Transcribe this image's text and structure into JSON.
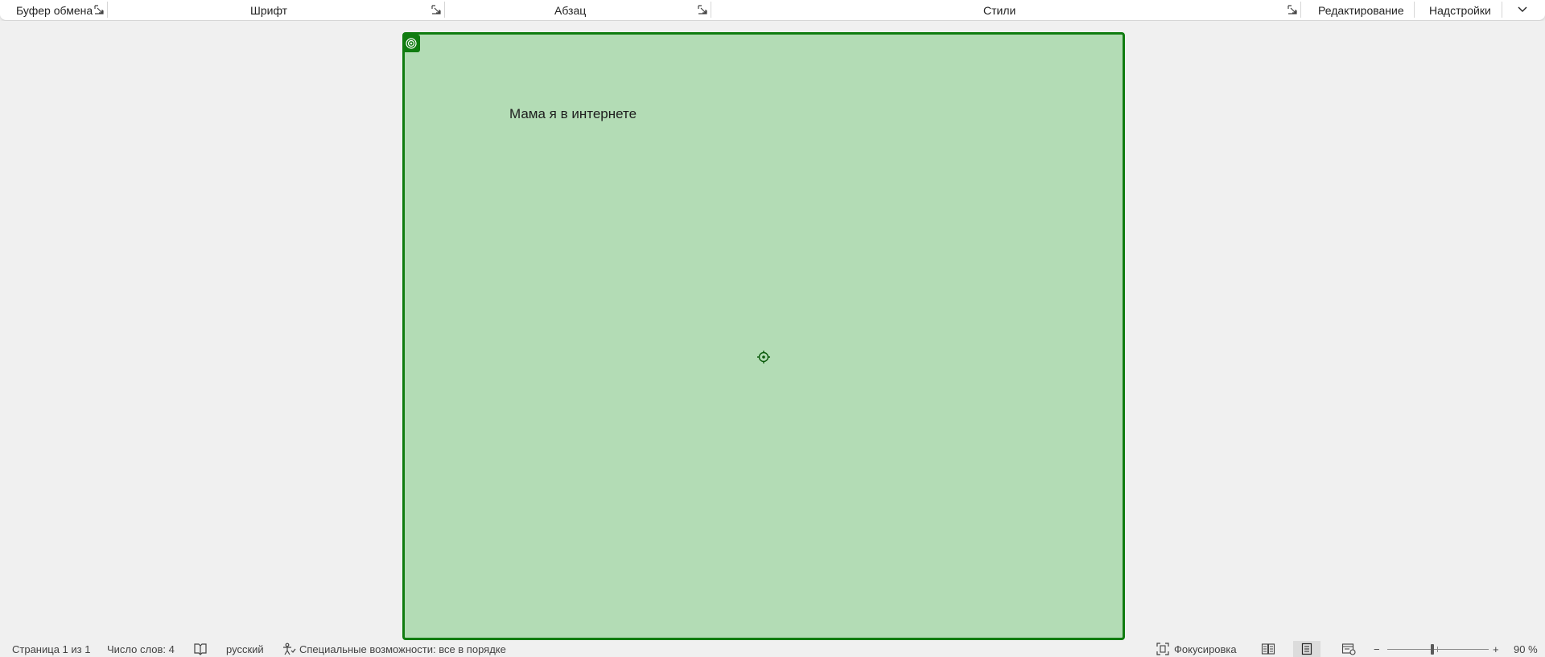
{
  "ribbon": {
    "groups": [
      {
        "label": "Буфер обмена"
      },
      {
        "label": "Шрифт"
      },
      {
        "label": "Абзац"
      },
      {
        "label": "Стили"
      },
      {
        "label": "Редактирование"
      },
      {
        "label": "Надстройки"
      }
    ],
    "launcher_icon": "dialog-launcher-icon",
    "collapse_icon": "chevron-down-icon"
  },
  "document": {
    "text": "Мама я в интернете",
    "fill_color": "#b3dcb5",
    "border_color": "#107c10"
  },
  "status": {
    "page": "Страница 1 из 1",
    "words": "Число слов: 4",
    "language": "русский",
    "accessibility": "Специальные возможности: все в порядке",
    "focus": "Фокусировка",
    "zoom_label": "90 %",
    "zoom_percent": 90,
    "zoom_minus": "−",
    "zoom_plus": "+"
  },
  "colors": {
    "accent": "#107c10",
    "background": "#f0f0f0"
  }
}
